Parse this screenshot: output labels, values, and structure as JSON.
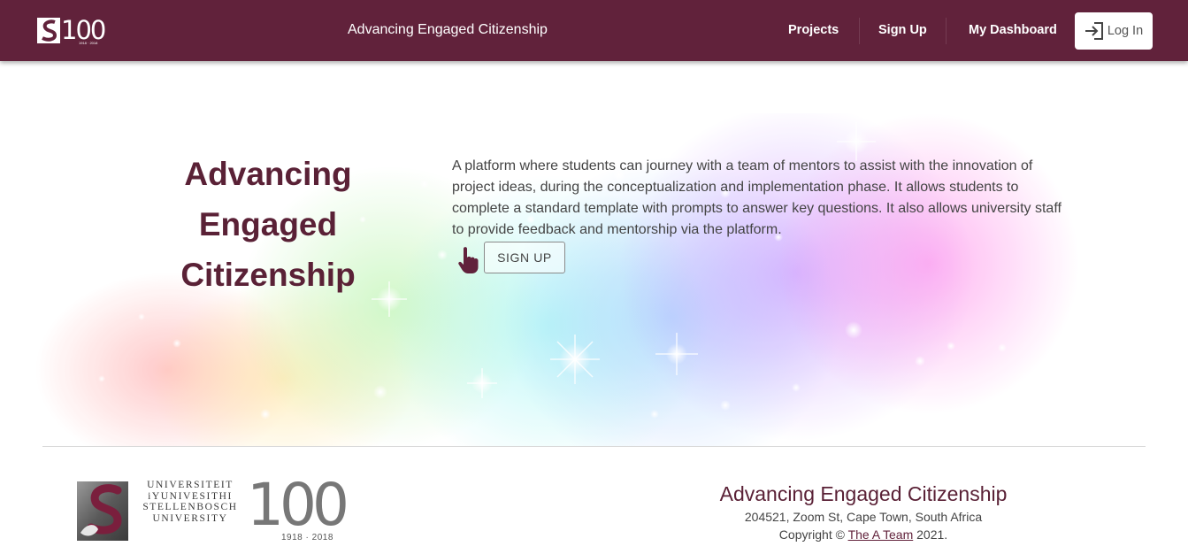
{
  "navbar": {
    "brand_text": "100",
    "brand_years": "1918 · 2018",
    "title": "Advancing Engaged Citizenship",
    "links": [
      "Projects",
      "Sign Up",
      "My Dashboard"
    ],
    "login_label": "Log In",
    "bg_color": "#61223b"
  },
  "hero": {
    "heading_lines": [
      "Advancing",
      "Engaged",
      "Citizenship"
    ],
    "description": "A platform where students can journey with a team of mentors to assist with the innovation of project ideas, during the conceptualization and implementation phase. It allows students to complete a standard template with prompts to answer key questions. It also allows university staff to provide feedback and mentorship via the platform.",
    "signup_label": "SIGN UP",
    "pointer_icon": "hand-pointer-icon",
    "heading_color": "#5a2136"
  },
  "footer": {
    "university_lines": [
      "UNIVERSITEIT",
      "iYUNIVESITHI",
      "STELLENBOSCH",
      "UNIVERSITY"
    ],
    "hundred": "100",
    "hundred_years": "1918 · 2018",
    "title": "Advancing Engaged Citizenship",
    "address": "204521, Zoom St, Cape Town, South Africa",
    "copyright_prefix": "Copyright ©",
    "copyright_link": "The A Team",
    "copyright_suffix": "2021."
  }
}
